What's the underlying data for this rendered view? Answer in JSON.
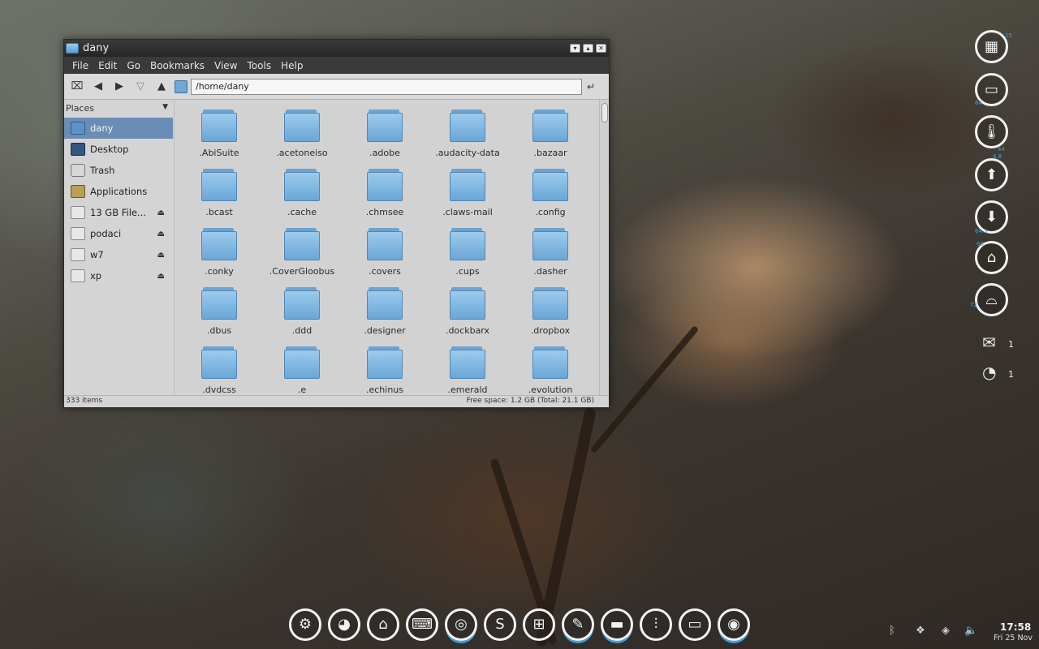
{
  "window": {
    "title": "dany",
    "menu": [
      "File",
      "Edit",
      "Go",
      "Bookmarks",
      "View",
      "Tools",
      "Help"
    ],
    "location": "/home/dany",
    "places_header": "Places",
    "places": [
      {
        "label": "dany",
        "icon": "home-folder-icon",
        "selected": true
      },
      {
        "label": "Desktop",
        "icon": "desktop-icon"
      },
      {
        "label": "Trash",
        "icon": "trash-icon"
      },
      {
        "label": "Applications",
        "icon": "applications-icon"
      },
      {
        "label": "13 GB File...",
        "icon": "drive-icon",
        "eject": true
      },
      {
        "label": "podaci",
        "icon": "drive-icon",
        "eject": true
      },
      {
        "label": "w7",
        "icon": "drive-icon",
        "eject": true
      },
      {
        "label": "xp",
        "icon": "drive-icon",
        "eject": true
      }
    ],
    "files": [
      ".AbiSuite",
      ".acetoneiso",
      ".adobe",
      ".audacity-data",
      ".bazaar",
      ".bcast",
      ".cache",
      ".chmsee",
      ".claws-mail",
      ".config",
      ".conky",
      ".CoverGloobus",
      ".covers",
      ".cups",
      ".dasher",
      ".dbus",
      ".ddd",
      ".designer",
      ".dockbarx",
      ".dropbox",
      ".dvdcss",
      ".e",
      ".echinus",
      ".emerald",
      ".evolution"
    ],
    "status_items": "333 items",
    "status_free": "Free space: 1.2 GB (Total: 21.1 GB)"
  },
  "monitor": {
    "cpu_value": "15",
    "ram_value": "64",
    "temp_value": "44",
    "up_value": "4.8",
    "down_value": "64.5",
    "home_value": "68",
    "disk_value": "72",
    "mail_count": "1",
    "pacman_count": "1"
  },
  "dock": [
    "settings",
    "firefox",
    "home",
    "keyboard",
    "chrome",
    "skype",
    "apps-grid",
    "editor",
    "files",
    "mixer",
    "chat",
    "radar"
  ],
  "clock": {
    "time": "17:58",
    "date": "Fri 25 Nov"
  },
  "colors": {
    "accent": "#3aa0e6",
    "selection": "#6b8cb4"
  }
}
